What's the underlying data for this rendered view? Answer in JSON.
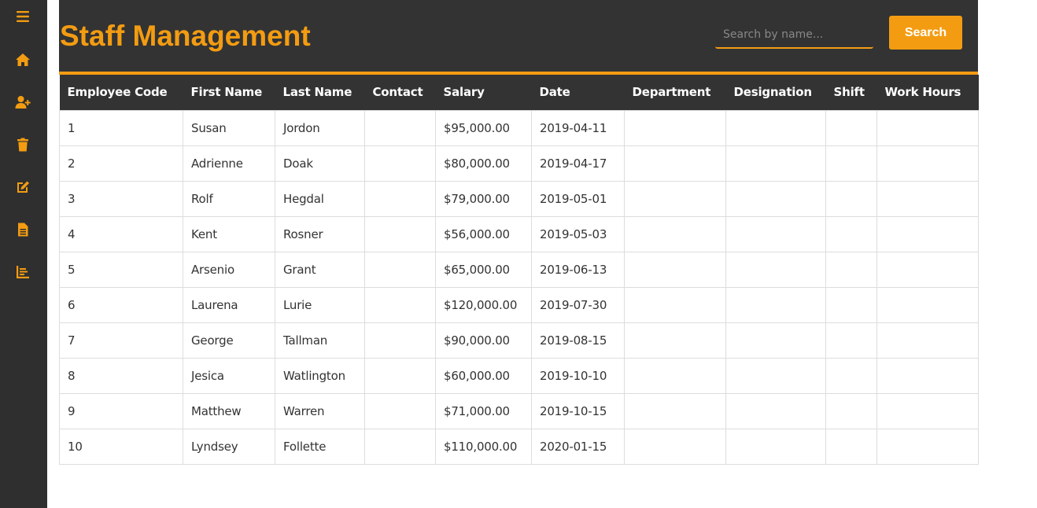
{
  "app": {
    "title": "Staff Management",
    "accent_color": "#f39c12",
    "header_color": "#333333",
    "sidebar_color": "#2f2f2f"
  },
  "sidebar": {
    "items": [
      {
        "icon": "menu-icon"
      },
      {
        "icon": "home-icon"
      },
      {
        "icon": "add-user-icon"
      },
      {
        "icon": "trash-icon"
      },
      {
        "icon": "edit-icon"
      },
      {
        "icon": "document-icon"
      },
      {
        "icon": "chart-icon"
      }
    ]
  },
  "search": {
    "placeholder": "Search by name...",
    "button_label": "Search"
  },
  "table": {
    "columns": [
      "Employee Code",
      "First Name",
      "Last Name",
      "Contact",
      "Salary",
      "Date",
      "Department",
      "Designation",
      "Shift",
      "Work Hours"
    ],
    "rows": [
      [
        "1",
        "Susan",
        "Jordon",
        "",
        "$95,000.00",
        "2019-04-11",
        "",
        "",
        "",
        ""
      ],
      [
        "2",
        "Adrienne",
        "Doak",
        "",
        "$80,000.00",
        "2019-04-17",
        "",
        "",
        "",
        ""
      ],
      [
        "3",
        "Rolf",
        "Hegdal",
        "",
        "$79,000.00",
        "2019-05-01",
        "",
        "",
        "",
        ""
      ],
      [
        "4",
        "Kent",
        "Rosner",
        "",
        "$56,000.00",
        "2019-05-03",
        "",
        "",
        "",
        ""
      ],
      [
        "5",
        "Arsenio",
        "Grant",
        "",
        "$65,000.00",
        "2019-06-13",
        "",
        "",
        "",
        ""
      ],
      [
        "6",
        "Laurena",
        "Lurie",
        "",
        "$120,000.00",
        "2019-07-30",
        "",
        "",
        "",
        ""
      ],
      [
        "7",
        "George",
        "Tallman",
        "",
        "$90,000.00",
        "2019-08-15",
        "",
        "",
        "",
        ""
      ],
      [
        "8",
        "Jesica",
        "Watlington",
        "",
        "$60,000.00",
        "2019-10-10",
        "",
        "",
        "",
        ""
      ],
      [
        "9",
        "Matthew",
        "Warren",
        "",
        "$71,000.00",
        "2019-10-15",
        "",
        "",
        "",
        ""
      ],
      [
        "10",
        "Lyndsey",
        "Follette",
        "",
        "$110,000.00",
        "2020-01-15",
        "",
        "",
        "",
        ""
      ]
    ]
  }
}
